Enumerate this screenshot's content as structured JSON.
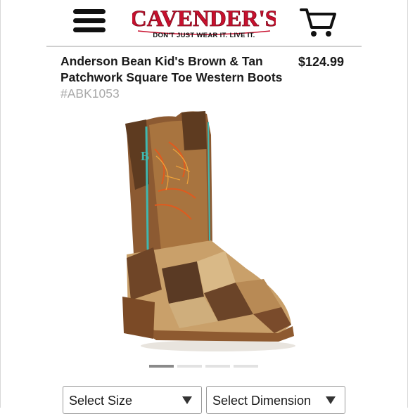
{
  "header": {
    "logo_text": "CAVENDER'S",
    "logo_tagline": "DON'T JUST WEAR IT. LIVE IT.",
    "menu_icon": "hamburger-menu-icon",
    "cart_icon": "shopping-cart-icon"
  },
  "product": {
    "title": "Anderson Bean Kid's Brown & Tan Patchwork Square Toe Western Boots",
    "sku": "#ABK1053",
    "price": "$124.99"
  },
  "carousel": {
    "slide_count": 4,
    "active_index": 0
  },
  "options": {
    "size_label": "Select Size",
    "dimension_label": "Select Dimension"
  },
  "colors": {
    "logo_red": "#c8102e",
    "accent_turquoise": "#3fb8b0"
  }
}
